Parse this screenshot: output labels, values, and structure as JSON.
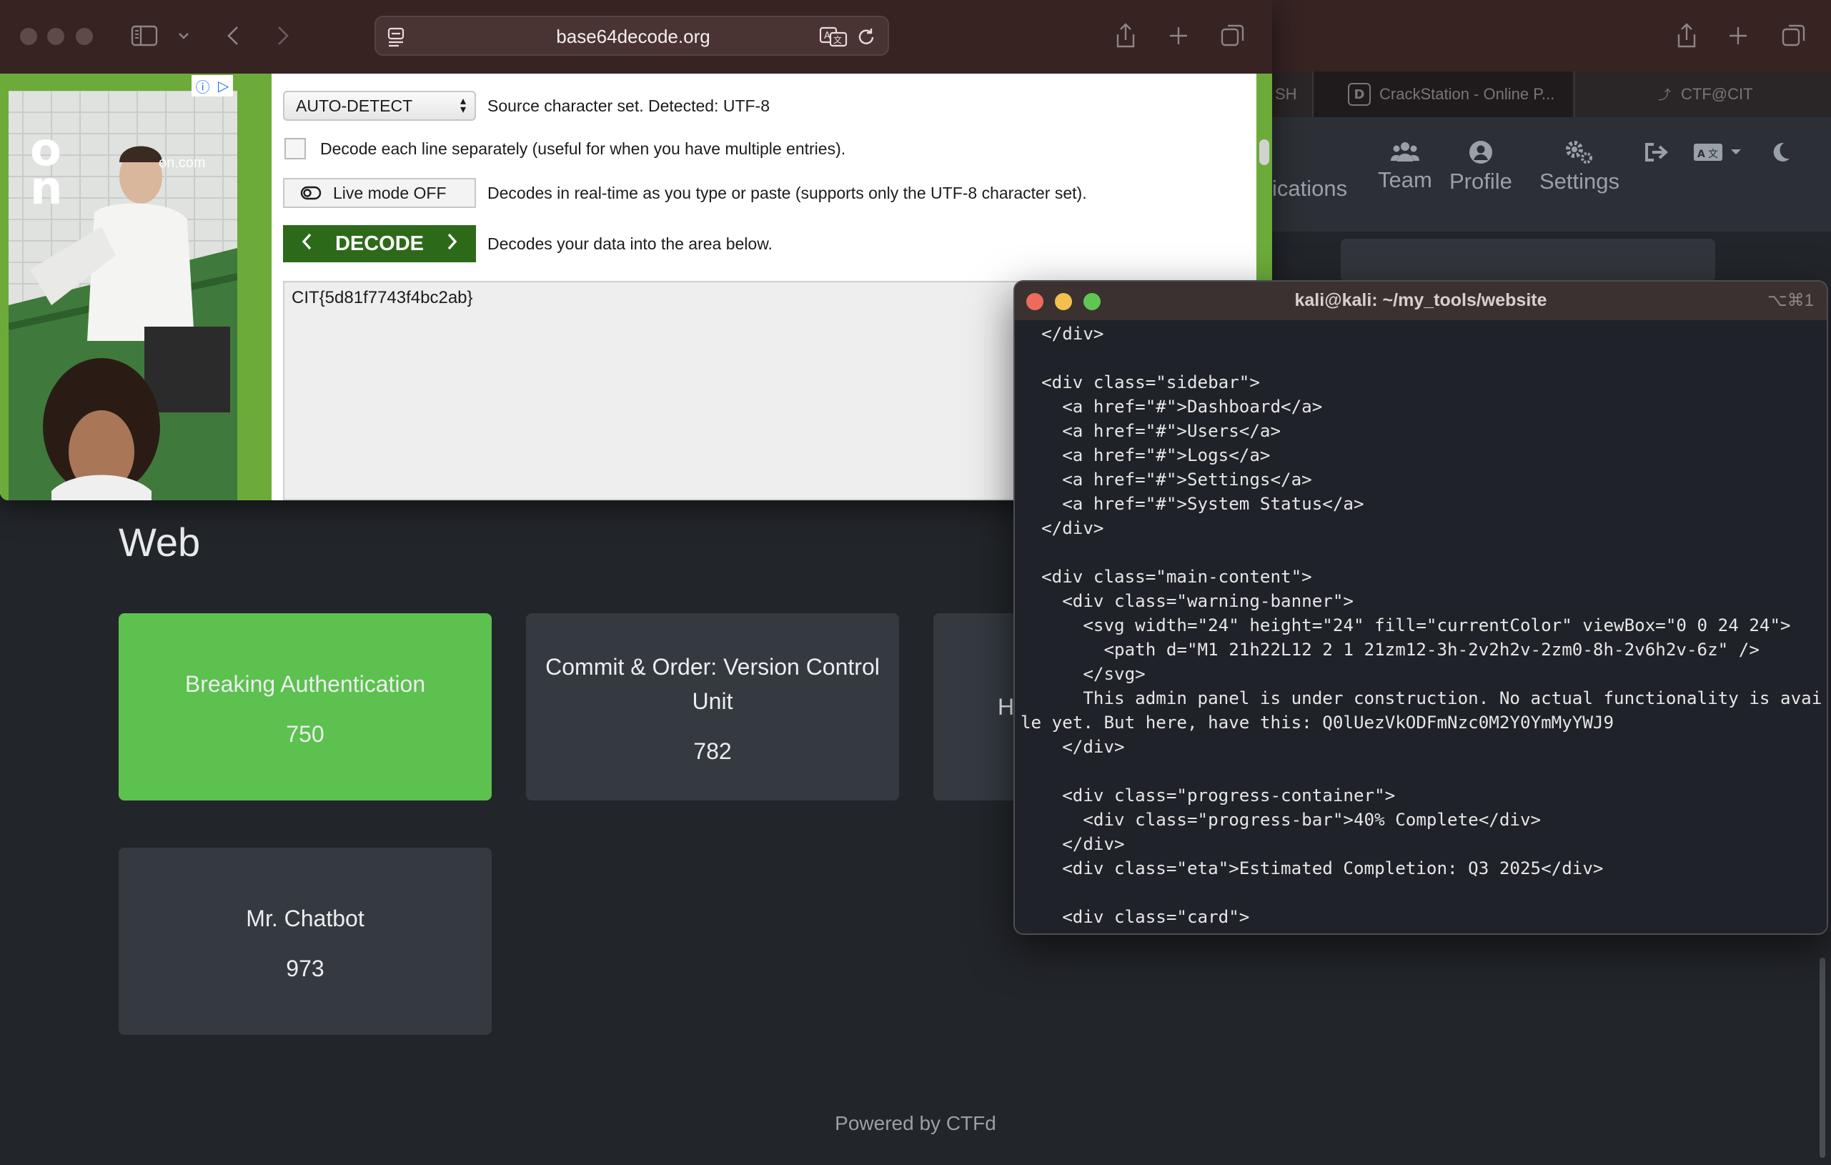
{
  "ctfd": {
    "tabs": [
      "SH",
      "CrackStation - Online P...",
      "CTF@CIT"
    ],
    "nav": [
      "ications",
      "Team",
      "Profile",
      "Settings"
    ],
    "category": "Web",
    "challenges": [
      {
        "name": "Breaking Authentication",
        "points": "750"
      },
      {
        "name": "Commit & Order: Version Control Unit",
        "points": "782"
      },
      {
        "name": "H",
        "points": ""
      },
      {
        "name": "Mr. Chatbot",
        "points": "973"
      }
    ],
    "footer": "Powered by CTFd"
  },
  "decoder": {
    "url": "base64decode.org",
    "charset_value": "AUTO-DETECT",
    "charset_desc": "Source character set. Detected: UTF-8",
    "line_desc": "Decode each line separately (useful for when you have multiple entries).",
    "live_label": "Live mode OFF",
    "live_desc": "Decodes in real-time as you type or paste (supports only the UTF-8 character set).",
    "decode_label": "DECODE",
    "decode_desc": "Decodes your data into the area below.",
    "output": "CIT{5d81f7743f4bc2ab}",
    "ad_domain": "on.com"
  },
  "terminal": {
    "title": "kali@kali: ~/my_tools/website",
    "shortcut": "⌥⌘1",
    "lines": [
      "  </div>",
      "",
      "  <div class=\"sidebar\">",
      "    <a href=\"#\">Dashboard</a>",
      "    <a href=\"#\">Users</a>",
      "    <a href=\"#\">Logs</a>",
      "    <a href=\"#\">Settings</a>",
      "    <a href=\"#\">System Status</a>",
      "  </div>",
      "",
      "  <div class=\"main-content\">",
      "    <div class=\"warning-banner\">",
      "      <svg width=\"24\" height=\"24\" fill=\"currentColor\" viewBox=\"0 0 24 24\">",
      "        <path d=\"M1 21h22L12 2 1 21zm12-3h-2v2h2v-2zm0-8h-2v6h2v-6z\" />",
      "      </svg>",
      "      This admin panel is under construction. No actual functionality is availab",
      "le yet. But here, have this: Q0lUezVkODFmNzc0M2Y0YmMyYWJ9",
      "    </div>",
      "",
      "    <div class=\"progress-container\">",
      "      <div class=\"progress-bar\">40% Complete</div>",
      "    </div>",
      "    <div class=\"eta\">Estimated Completion: Q3 2025</div>",
      "",
      "    <div class=\"card\">"
    ]
  }
}
